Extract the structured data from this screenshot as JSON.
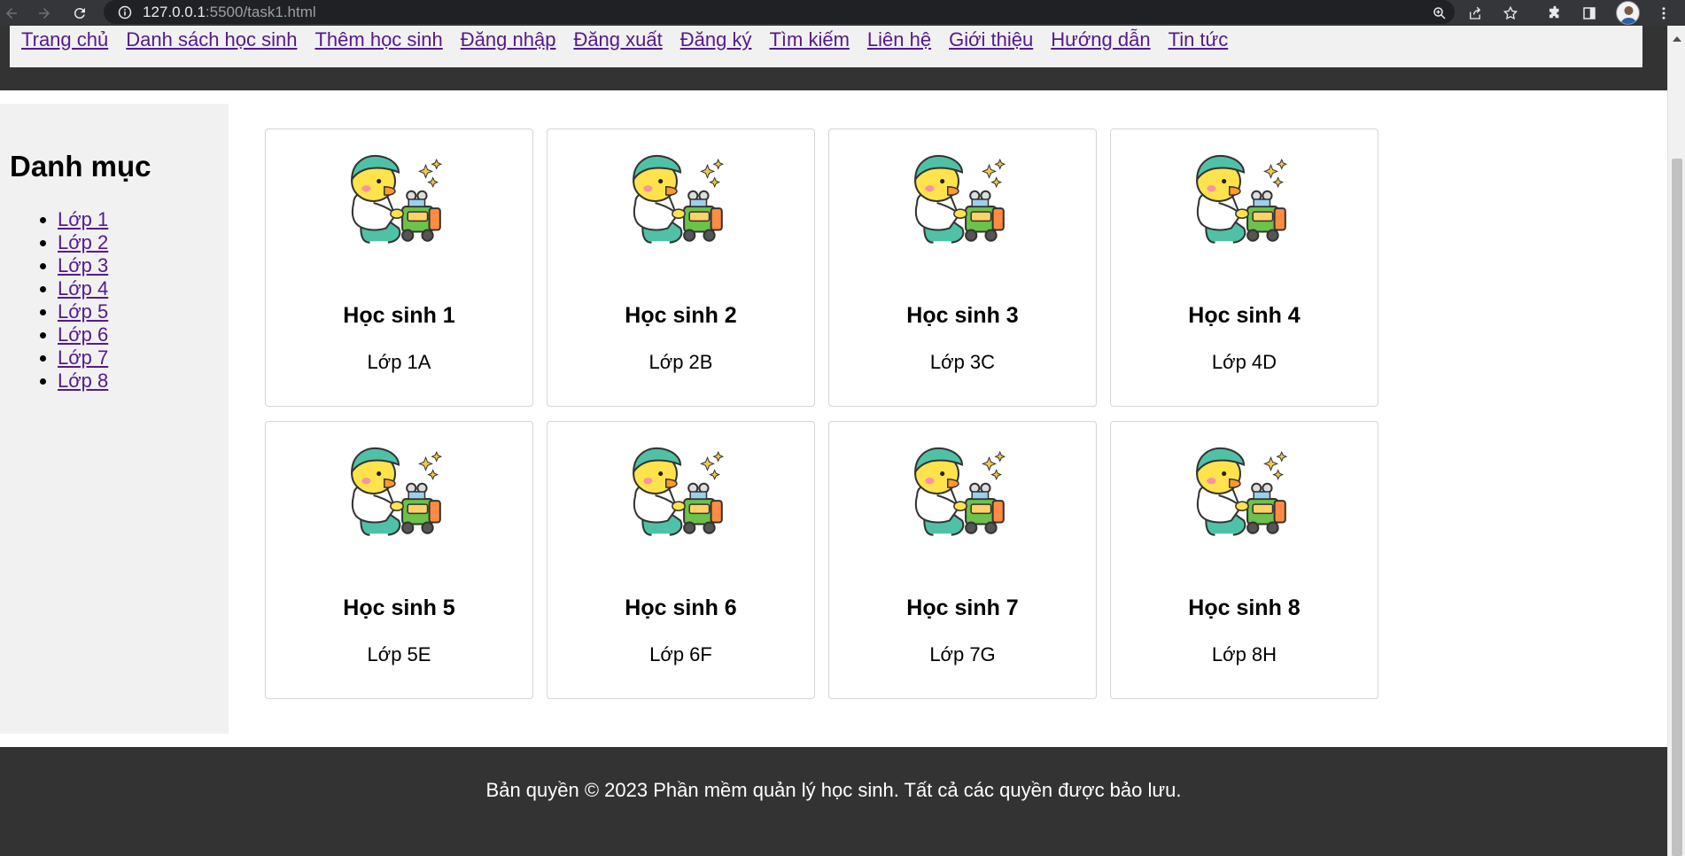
{
  "browser": {
    "url_host": "127.0.0.1",
    "url_port_path": ":5500/task1.html",
    "colors": {
      "chrome": "#35363a",
      "omnibox": "#202124"
    }
  },
  "nav": {
    "links": [
      "Trang chủ",
      "Danh sách học sinh",
      "Thêm học sinh",
      "Đăng nhập",
      "Đăng xuất",
      "Đăng ký",
      "Tìm kiếm",
      "Liên hệ",
      "Giới thiệu",
      "Hướng dẫn",
      "Tin tức"
    ]
  },
  "sidebar": {
    "title": "Danh mục",
    "items": [
      "Lớp 1",
      "Lớp 2",
      "Lớp 3",
      "Lớp 4",
      "Lớp 5",
      "Lớp 6",
      "Lớp 7",
      "Lớp 8"
    ]
  },
  "students": [
    {
      "name": "Học sinh 1",
      "class": "Lớp 1A",
      "image": "duck-robot-illustration"
    },
    {
      "name": "Học sinh 2",
      "class": "Lớp 2B",
      "image": "duck-robot-illustration"
    },
    {
      "name": "Học sinh 3",
      "class": "Lớp 3C",
      "image": "duck-robot-illustration"
    },
    {
      "name": "Học sinh 4",
      "class": "Lớp 4D",
      "image": "duck-robot-illustration"
    },
    {
      "name": "Học sinh 5",
      "class": "Lớp 5E",
      "image": "duck-robot-illustration"
    },
    {
      "name": "Học sinh 6",
      "class": "Lớp 6F",
      "image": "duck-robot-illustration"
    },
    {
      "name": "Học sinh 7",
      "class": "Lớp 7G",
      "image": "duck-robot-illustration"
    },
    {
      "name": "Học sinh 8",
      "class": "Lớp 8H",
      "image": "duck-robot-illustration"
    }
  ],
  "footer": {
    "text": "Bản quyền © 2023 Phần mềm quản lý học sinh. Tất cả các quyền được bảo lưu."
  },
  "colors": {
    "header_bg": "#333333",
    "nav_bg": "#f1f1f1",
    "link": "#551a8b",
    "footer_bg": "#333333",
    "card_border": "#d6d6d6"
  }
}
